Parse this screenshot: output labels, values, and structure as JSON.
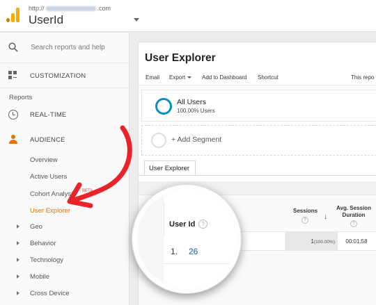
{
  "header": {
    "account_prefix": "http://",
    "account_suffix": ".com",
    "view_name": "UserId"
  },
  "sidebar": {
    "search_placeholder": "Search reports and help",
    "customization": "CUSTOMIZATION",
    "reports_heading": "Reports",
    "realtime": "REAL-TIME",
    "audience": "AUDIENCE",
    "audience_items": [
      "Overview",
      "Active Users",
      "Cohort Analysis",
      "User Explorer"
    ],
    "beta_badge": "BETA",
    "collapsed_items": [
      "Geo",
      "Behavior",
      "Technology",
      "Mobile",
      "Cross Device"
    ]
  },
  "main": {
    "title": "User Explorer",
    "toolbar": {
      "email": "Email",
      "export": "Export",
      "add_to_dashboard": "Add to Dashboard",
      "shortcut": "Shortcut",
      "this_report": "This repo"
    },
    "segment": {
      "name": "All Users",
      "percent": "100.00% Users"
    },
    "add_segment": "+ Add Segment",
    "tab": "User Explorer",
    "table": {
      "col_user_id": "User Id",
      "col_sessions": "Sessions",
      "col_duration_line1": "Avg. Session",
      "col_duration_line2": "Duration",
      "help_mark": "?",
      "sort_arrow": "↓",
      "row": {
        "index": "1.",
        "user_id": "26",
        "sessions": "1",
        "sessions_pct": "(100.00%)",
        "duration": "00:01:58"
      }
    }
  },
  "colors": {
    "accent": "#e37400",
    "segment_blue": "#058dc7",
    "annotation_red": "#e8232a"
  }
}
